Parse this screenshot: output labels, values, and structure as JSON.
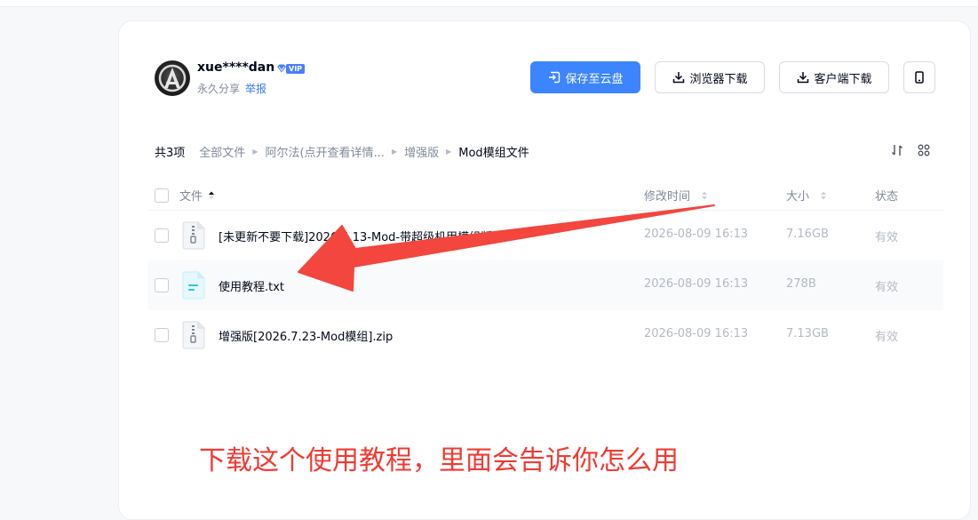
{
  "owner": {
    "username": "xue****dan",
    "vip_label": "VIP",
    "share_type": "永久分享",
    "report_label": "举报"
  },
  "actions": {
    "save_label": "保存至云盘",
    "browser_download_label": "浏览器下载",
    "client_download_label": "客户端下载"
  },
  "breadcrumb": {
    "count": "共3项",
    "items": [
      "全部文件",
      "阿尔法(点开查看详情...",
      "增强版",
      "Mod模组文件"
    ]
  },
  "table": {
    "headers": {
      "name": "文件",
      "modified": "修改时间",
      "size": "大小",
      "status": "状态"
    },
    "rows": [
      {
        "name": "[未更新不要下载]2026.5.13-Mod-带超级机甲模组版本",
        "modified": "2026-08-09 16:13",
        "size": "7.16GB",
        "status": "有效",
        "icon": "zip-file-icon"
      },
      {
        "name": "使用教程.txt",
        "modified": "2026-08-09 16:13",
        "size": "278B",
        "status": "有效",
        "icon": "txt-file-icon"
      },
      {
        "name": "增强版[2026.7.23-Mod模组].zip",
        "modified": "2026-08-09 16:13",
        "size": "7.13GB",
        "status": "有效",
        "icon": "zip-file-icon"
      }
    ]
  },
  "annotation": {
    "text": "下载这个使用教程，里面会告诉你怎么用",
    "color": "#ef3b32"
  },
  "colors": {
    "primary": "#3c85ff",
    "link": "#3c76ff",
    "muted": "#818999"
  }
}
